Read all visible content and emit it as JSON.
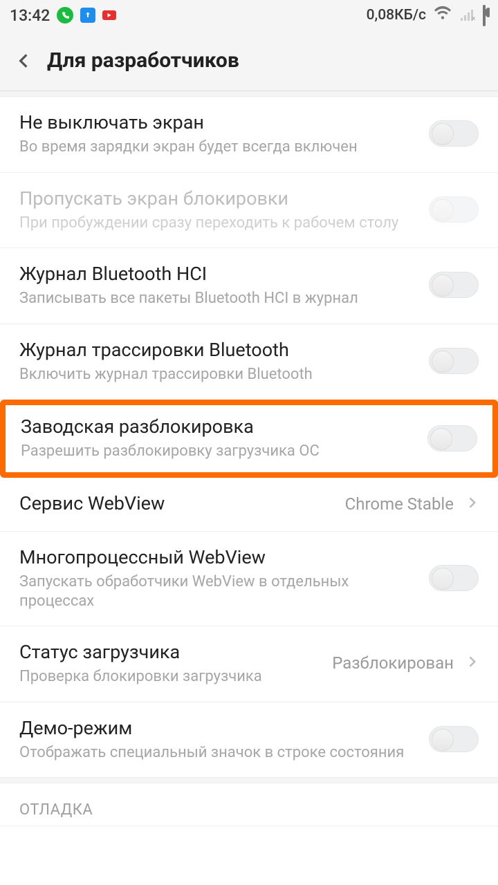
{
  "status": {
    "time": "13:42",
    "net_speed": "0,08КБ/с"
  },
  "header": {
    "title": "Для разработчиков"
  },
  "rows": {
    "stay_awake": {
      "title": "Не выключать экран",
      "sub": "Во время зарядки экран будет всегда включен"
    },
    "skip_lock": {
      "title": "Пропускать экран блокировки",
      "sub": "При пробуждении сразу переходить к рабочем столу"
    },
    "bt_hci": {
      "title": "Журнал Bluetooth HCI",
      "sub": "Записывать все пакеты Bluetooth HCI в журнал"
    },
    "bt_trace": {
      "title": "Журнал трассировки Bluetooth",
      "sub": "Включить журнал трассировки Bluetooth"
    },
    "oem_unlock": {
      "title": "Заводская разблокировка",
      "sub": "Разрешить разблокировку загрузчика ОС"
    },
    "webview": {
      "title": "Сервис WebView",
      "value": "Chrome Stable"
    },
    "multi_wv": {
      "title": "Многопроцессный WebView",
      "sub": "Запускать обработчики WebView в отдельных процессах"
    },
    "bl_status": {
      "title": "Статус загрузчика",
      "sub": "Проверка блокировки загрузчика",
      "value": "Разблокирован"
    },
    "demo": {
      "title": "Демо-режим",
      "sub": "Отображать специальный значок в строке состояния"
    }
  },
  "sections": {
    "debug": "ОТЛАДКА"
  }
}
